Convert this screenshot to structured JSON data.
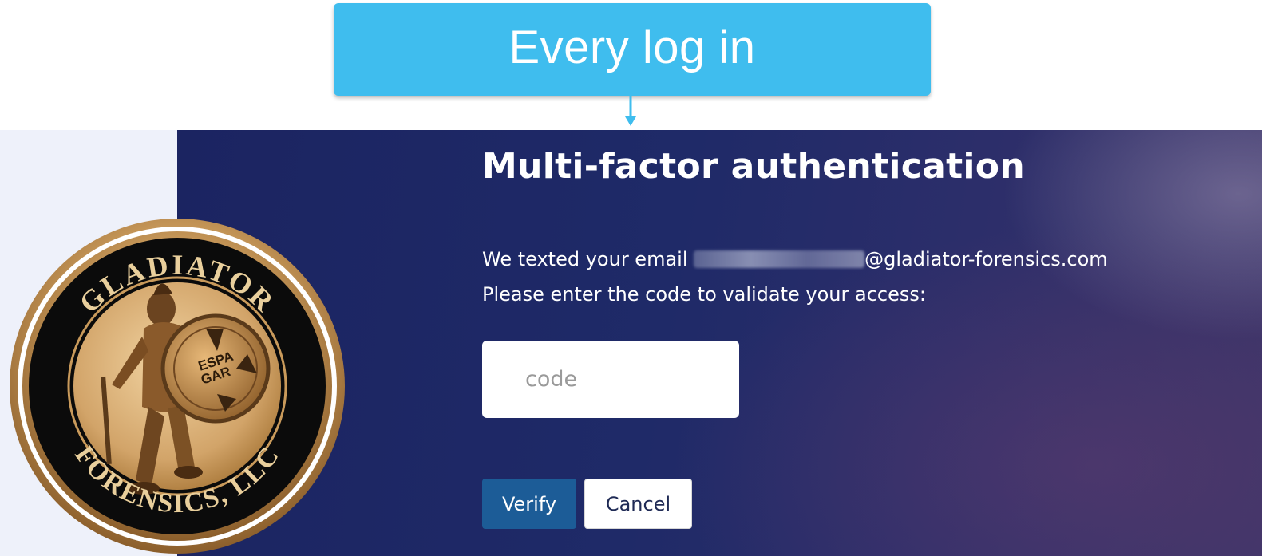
{
  "callout": {
    "text": "Every log in",
    "background": "#3fbdee"
  },
  "mfa": {
    "title": "Multi-factor authentication",
    "line1_prefix": "We texted your email ",
    "email_domain": "@gladiator-forensics.com",
    "line2": "Please enter the code to validate your access:",
    "code_placeholder": "code",
    "code_value": "",
    "verify_label": "Verify",
    "cancel_label": "Cancel"
  },
  "logo": {
    "top_text": "GLADIATOR",
    "bottom_text": "FORENSICS, LLC",
    "shield_text_1": "ESPA",
    "shield_text_2": "GAR",
    "icon": "gladiator-seal-logo"
  },
  "colors": {
    "panel_left": "#eef1fa",
    "panel_right": "#1f2a68",
    "verify_button": "#1c5c97",
    "logo_gold": "#c99a5b"
  }
}
